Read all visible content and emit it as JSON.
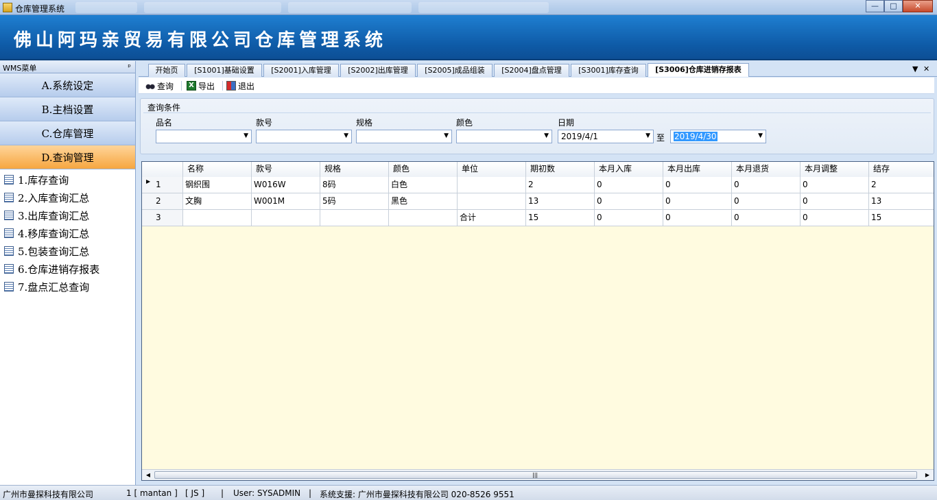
{
  "window": {
    "title": "仓库管理系统",
    "buttons": {
      "minimize": "—",
      "maximize": "□",
      "close": "✕"
    }
  },
  "banner": {
    "title": "佛山阿玛亲贸易有限公司仓库管理系统"
  },
  "sidebar": {
    "header": "WMS菜单",
    "pin": "ᵖ",
    "groups": [
      {
        "label": "A.系统设定"
      },
      {
        "label": "B.主档设置"
      },
      {
        "label": "C.仓库管理"
      },
      {
        "label": "D.查询管理"
      }
    ],
    "items": [
      {
        "label": "1.库存查询"
      },
      {
        "label": "2.入库查询汇总"
      },
      {
        "label": "3.出库查询汇总"
      },
      {
        "label": "4.移库查询汇总"
      },
      {
        "label": "5.包装查询汇总"
      },
      {
        "label": "6.仓库进销存报表"
      },
      {
        "label": "7.盘点汇总查询"
      }
    ]
  },
  "tabs": [
    {
      "label": "开始页"
    },
    {
      "label": "[S1001]基础设置"
    },
    {
      "label": "[S2001]入库管理"
    },
    {
      "label": "[S2002]出库管理"
    },
    {
      "label": "[S2005]成品组装"
    },
    {
      "label": "[S2004]盘点管理"
    },
    {
      "label": "[S3001]库存查询"
    },
    {
      "label": "[S3006]仓库进销存报表"
    }
  ],
  "tab_controls": {
    "dropdown": "▼",
    "close": "✕"
  },
  "toolbar": {
    "query": "查询",
    "export": "导出",
    "exit": "退出",
    "excel_glyph": "X"
  },
  "query_panel": {
    "title": "查询条件",
    "fields": {
      "product": {
        "label": "品名",
        "value": ""
      },
      "style": {
        "label": "款号",
        "value": ""
      },
      "spec": {
        "label": "规格",
        "value": ""
      },
      "color": {
        "label": "颜色",
        "value": ""
      },
      "date": {
        "label": "日期",
        "from": "2019/4/1",
        "to_label": "至",
        "to": "2019/4/30"
      }
    }
  },
  "grid": {
    "columns": [
      "名称",
      "款号",
      "规格",
      "颜色",
      "单位",
      "期初数",
      "本月入库",
      "本月出库",
      "本月退货",
      "本月调整",
      "结存"
    ],
    "rows": [
      {
        "num": "1",
        "cells": [
          "钢织围",
          "W016W",
          "8码",
          "白色",
          "",
          "2",
          "0",
          "0",
          "0",
          "0",
          "2"
        ]
      },
      {
        "num": "2",
        "cells": [
          "文胸",
          "W001M",
          "5码",
          "黑色",
          "",
          "13",
          "0",
          "0",
          "0",
          "0",
          "13"
        ]
      },
      {
        "num": "3",
        "cells": [
          "",
          "",
          "",
          "",
          "合计",
          "15",
          "0",
          "0",
          "0",
          "0",
          "15"
        ]
      }
    ],
    "row_indicator": "▶",
    "scroll": {
      "left": "◀",
      "right": "▶",
      "grip": "|||"
    }
  },
  "statusbar": {
    "company": "广州市曼探科技有限公司",
    "session": "1 [ mantan ]",
    "code": "[ JS ]",
    "user": "User: SYSADMIN",
    "support": "系统支援: 广州市曼探科技有限公司 020-8526 9551",
    "sep": "|"
  }
}
